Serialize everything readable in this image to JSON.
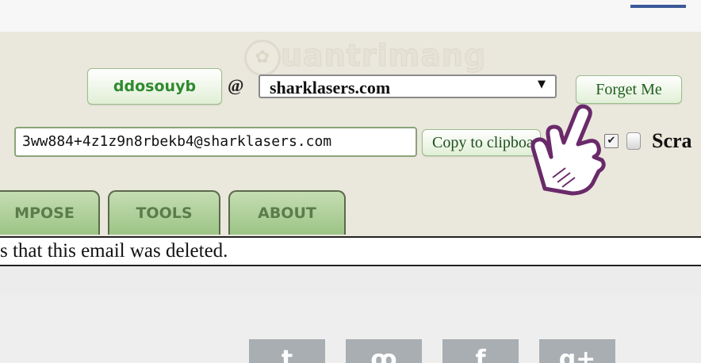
{
  "header": {
    "watermark_text": "uantrimang",
    "username": "ddosouyb",
    "at_symbol": "@",
    "domain_selected": "sharklasers.com",
    "forget_label": "Forget Me",
    "email_address": "3ww884+4z1z9n8rbekb4@sharklasers.com",
    "copy_label": "Copy to clipboard",
    "scramble_label": "Scra"
  },
  "tabs": [
    {
      "label": "MPOSE"
    },
    {
      "label": "TOOLS"
    },
    {
      "label": "ABOUT"
    }
  ],
  "notice_text": "s that this email was deleted.",
  "share": {
    "tumblr": "t",
    "stumble": "ꝏ",
    "facebook": "f",
    "gplus": "g+"
  },
  "colors": {
    "brand_green": "#2e8b2e",
    "header_bg": "#eae7dc",
    "tab_green": "#9cc486",
    "share_gray": "#a9aeb3",
    "hand_outline": "#6a2a6a"
  },
  "icons": {
    "pointer": "pointing-hand-icon",
    "dropdown": "chevron-down-icon",
    "scramble": "scramble-icon"
  }
}
